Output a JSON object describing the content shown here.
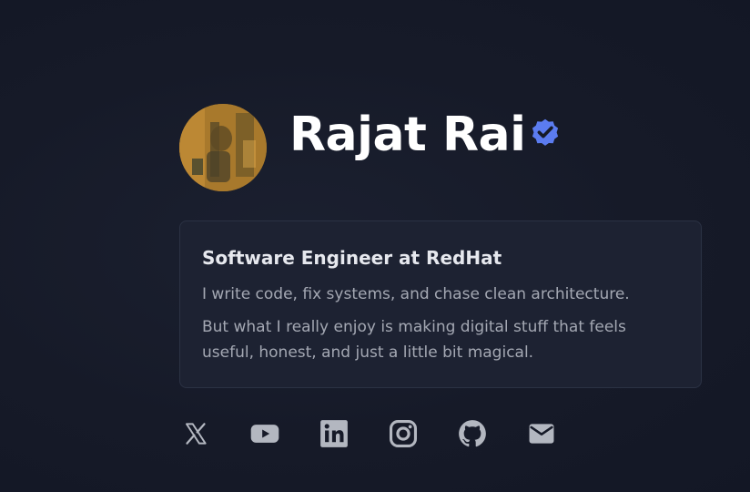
{
  "profile": {
    "name": "Rajat Rai",
    "verified": true
  },
  "card": {
    "title": "Software Engineer at RedHat",
    "lines": [
      "I write code, fix systems, and chase clean architecture.",
      "But what I really enjoy is making digital stuff that feels useful, honest, and just a little bit magical."
    ]
  },
  "socials": [
    {
      "icon": "x-icon"
    },
    {
      "icon": "youtube-icon"
    },
    {
      "icon": "linkedin-icon"
    },
    {
      "icon": "instagram-icon"
    },
    {
      "icon": "github-icon"
    },
    {
      "icon": "mail-icon"
    }
  ],
  "colors": {
    "background": "#161a28",
    "card_background": "#1d2232",
    "card_border": "#2b3244",
    "verified_badge": "#5b7cf0",
    "icon_color": "#b3b7c0",
    "name_color": "#ffffff",
    "body_text": "#a4a8b3"
  }
}
